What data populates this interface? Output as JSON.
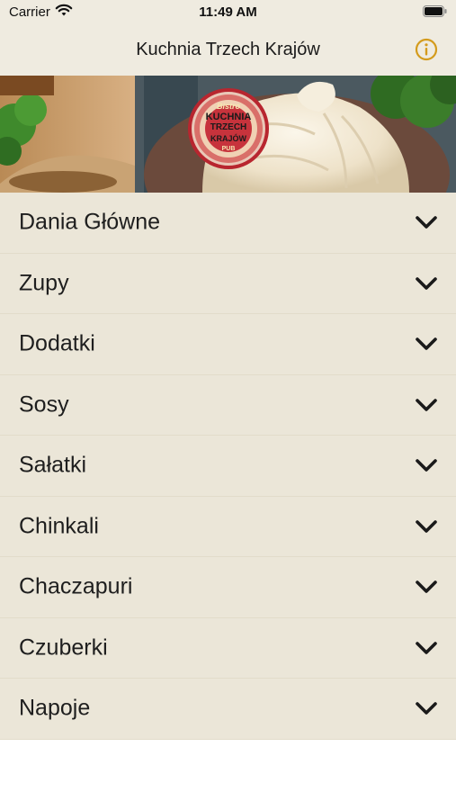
{
  "status_bar": {
    "carrier": "Carrier",
    "time": "11:49 AM"
  },
  "nav": {
    "title": "Kuchnia Trzech Krajów",
    "info_icon": "info-circle-icon",
    "accent_color": "#d49b1c"
  },
  "banner": {
    "logo_text": [
      "Bistro",
      "KUCHNIA",
      "TRZECH",
      "KRAJÓW",
      "PUB"
    ]
  },
  "menu": {
    "chevron_icon": "chevron-down-icon",
    "items": [
      {
        "label": "Dania Główne"
      },
      {
        "label": "Zupy"
      },
      {
        "label": "Dodatki"
      },
      {
        "label": "Sosy"
      },
      {
        "label": "Sałatki"
      },
      {
        "label": "Chinkali"
      },
      {
        "label": "Chaczapuri"
      },
      {
        "label": "Czuberki"
      },
      {
        "label": "Napoje"
      }
    ]
  }
}
